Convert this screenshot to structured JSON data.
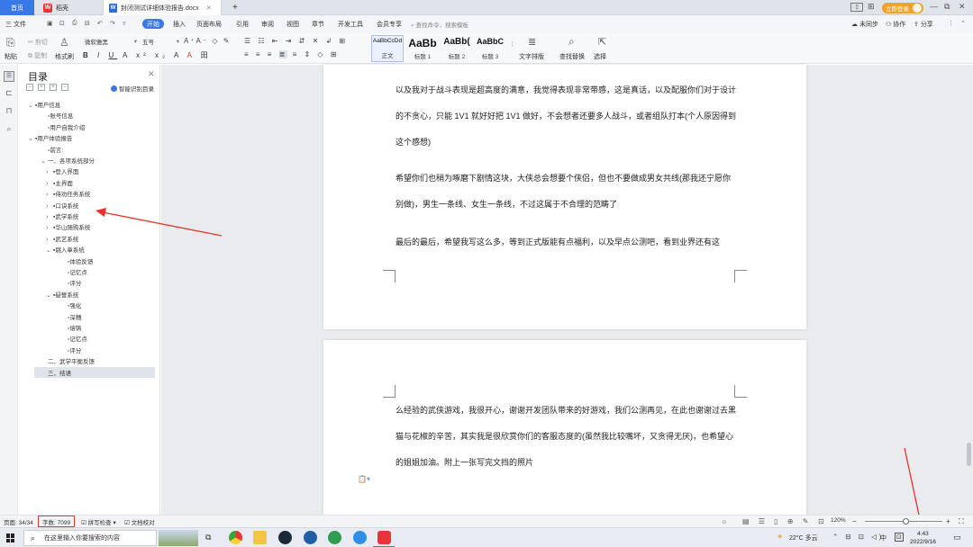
{
  "tabs": {
    "home": "首页",
    "daoke": "稻壳",
    "doc": "封闭测试详细体验报告.docx"
  },
  "topright": {
    "login": "立即登录"
  },
  "menu": {
    "file": "三 文件",
    "items": [
      "开始",
      "插入",
      "页面布局",
      "引用",
      "审阅",
      "视图",
      "章节",
      "开发工具",
      "会员专享"
    ],
    "search": "查找命令、搜索模板",
    "sync": "未同步",
    "collab": "协作",
    "share": "分享"
  },
  "ribbon": {
    "cut": "剪切",
    "copy": "复制",
    "paste": "粘贴",
    "format_painter": "格式刷",
    "font": "微软雅黑",
    "size": "五号",
    "styles": [
      {
        "preview": "AaBbCcDd",
        "label": "正文"
      },
      {
        "preview": "AaBb",
        "label": "标题 1"
      },
      {
        "preview": "AaBb(",
        "label": "标题 2"
      },
      {
        "preview": "AaBbC",
        "label": "标题 3"
      }
    ],
    "text_layout": "文字排版",
    "find_replace": "查找替换",
    "select": "选择"
  },
  "toc": {
    "title": "目录",
    "smart": "智能识别目录",
    "items": [
      {
        "text": "用户信息",
        "level": 1,
        "bullet": "▪",
        "chev": "⌄"
      },
      {
        "text": "账号信息",
        "level": 2,
        "bullet": "▫",
        "chev": ""
      },
      {
        "text": "用户自我介绍",
        "level": 2,
        "bullet": "▫",
        "chev": ""
      },
      {
        "text": "用户体验报告",
        "level": 1,
        "bullet": "▪",
        "chev": "⌄"
      },
      {
        "text": "前言:",
        "level": 2,
        "bullet": "▫",
        "chev": ""
      },
      {
        "text": "一、各项系统部分",
        "level": 2,
        "bullet": "",
        "chev": "⌄"
      },
      {
        "text": "登入界面",
        "level": 3,
        "bullet": "▪",
        "chev": "›"
      },
      {
        "text": "主界面",
        "level": 3,
        "bullet": "▪",
        "chev": "›"
      },
      {
        "text": "侍劝任务系统",
        "level": 3,
        "bullet": "▪",
        "chev": "›"
      },
      {
        "text": "口诀系统",
        "level": 3,
        "bullet": "▪",
        "chev": "›"
      },
      {
        "text": "武学系统",
        "level": 3,
        "bullet": "▪",
        "chev": "›"
      },
      {
        "text": "华山随购系统",
        "level": 3,
        "bullet": "▪",
        "chev": "›"
      },
      {
        "text": "武艺系统",
        "level": 3,
        "bullet": "▪",
        "chev": "›"
      },
      {
        "text": "跳入章系统",
        "level": 3,
        "bullet": "▪",
        "chev": "⌄"
      },
      {
        "text": "体验反馈",
        "level": 4,
        "bullet": "▫",
        "chev": ""
      },
      {
        "text": "记忆点",
        "level": 4,
        "bullet": "▫",
        "chev": ""
      },
      {
        "text": "评分",
        "level": 4,
        "bullet": "▫",
        "chev": ""
      },
      {
        "text": "疑誓系统",
        "level": 3,
        "bullet": "▪",
        "chev": "⌄"
      },
      {
        "text": "强化",
        "level": 4,
        "bullet": "▫",
        "chev": ""
      },
      {
        "text": "深穗",
        "level": 4,
        "bullet": "▫",
        "chev": ""
      },
      {
        "text": "熔铸",
        "level": 4,
        "bullet": "▫",
        "chev": ""
      },
      {
        "text": "记忆点",
        "level": 4,
        "bullet": "▫",
        "chev": ""
      },
      {
        "text": "评分",
        "level": 4,
        "bullet": "▫",
        "chev": ""
      },
      {
        "text": "二、武学平衡反馈",
        "level": 2,
        "bullet": "",
        "chev": ""
      },
      {
        "text": "三、结语",
        "level": 2,
        "bullet": "",
        "chev": ""
      }
    ]
  },
  "doc": {
    "p1": "以及我对于战斗表现是超高度的满意，我觉得表现非常带感，这是真话，以及配服你们对于设计的不贪心，只能 1V1 就好好把 1V1 做好，不会想者还要多人战斗，或者组队打本(个人原因得到这个感想)",
    "p2": "希望你们也稍为啄磨下剧情这块，大侠总会想要个侠侣，但也不要做成男女共线(那我还宁愿你别做)，男生一条线、女生一条线，不过这属于不合理的范畴了",
    "p3": "最后的最后，希望我写这么多，等到正式版能有点福利，以及早点公测吧，看到业界还有这",
    "p4": "么经验的武侠游戏，我很开心，谢谢开发团队带来的好游戏，我们公测再见，在此也谢谢过去黑猫与花椒的辛苦，其实我是很欣赏你们的客服态度的(虽然我比较嘴坏，又贪得无厌)，也希望心的姐姐加油。附上一张写完文挡的照片"
  },
  "status": {
    "page": "页面: 34/34",
    "words": "字数: 7099",
    "spell": "拼写检查",
    "proof": "文档校对",
    "zoom": "120%"
  },
  "taskbar": {
    "search": "在这里输入你要搜索的内容",
    "weather": "22°C 多云",
    "ime": "中",
    "time": "4:43",
    "date": "2022/9/16"
  },
  "colors": {
    "accent": "#3b78e7",
    "annotation": "#e8332a"
  }
}
